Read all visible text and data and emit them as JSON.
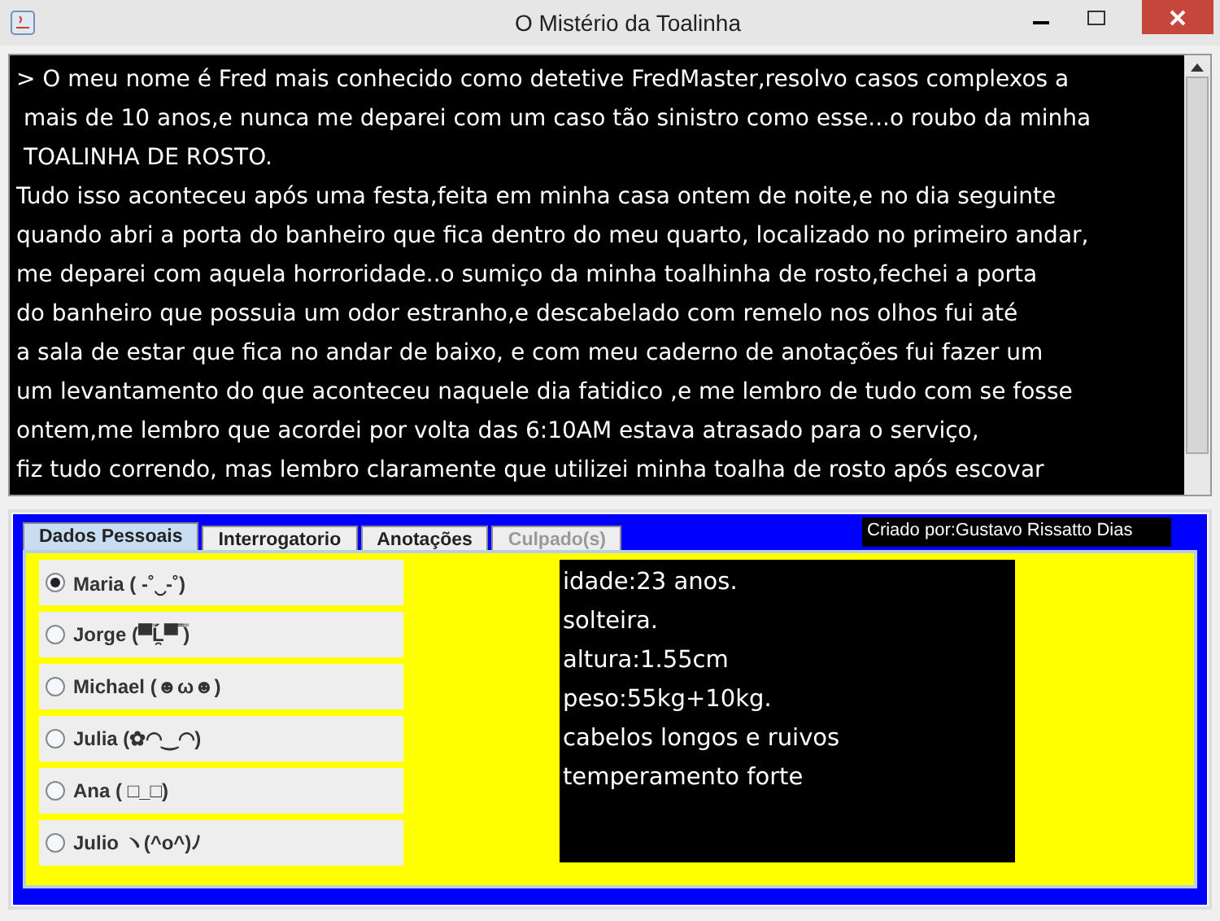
{
  "window": {
    "title": "O Mistério da Toalinha"
  },
  "story": {
    "lines": [
      "> O meu nome é Fred mais conhecido como detetive FredMaster,resolvo casos complexos a",
      " mais de 10 anos,e nunca me deparei com um caso tão sinistro como esse...o roubo da minha",
      " TOALINHA DE ROSTO.",
      "Tudo isso aconteceu após uma festa,feita em minha casa ontem de noite,e no dia seguinte",
      "quando abri a porta do banheiro que fica dentro do meu quarto, localizado no primeiro andar,",
      "me deparei com aquela horroridade..o sumiço da minha toalhinha de rosto,fechei a porta",
      "do banheiro que possuia um odor estranho,e descabelado com remelo nos olhos fui até",
      "a sala de estar que fica no andar de baixo, e com meu caderno de anotações fui fazer um",
      "um levantamento do que aconteceu naquele dia fatidico ,e me lembro de tudo com se fosse",
      "ontem,me lembro que acordei por volta das 6:10AM estava atrasado para o serviço,",
      "fiz tudo correndo, mas lembro claramente que utilizei minha toalha de rosto após escovar"
    ]
  },
  "tabs": [
    {
      "label": "Dados Pessoais",
      "selected": true,
      "disabled": false
    },
    {
      "label": "Interrogatorio",
      "selected": false,
      "disabled": false
    },
    {
      "label": "Anotações",
      "selected": false,
      "disabled": false
    },
    {
      "label": "Culpado(s)",
      "selected": false,
      "disabled": true
    }
  ],
  "credit": "Criado por:Gustavo Rissatto Dias",
  "suspects": [
    {
      "label": "Maria ( -˚‿-˚)",
      "selected": true
    },
    {
      "label": "Jorge (▀̿Ĺ̯▀̿ ̿)",
      "selected": false
    },
    {
      "label": "Michael  (☻ω☻)",
      "selected": false
    },
    {
      "label": "Julia (✿◠‿◠)",
      "selected": false
    },
    {
      "label": "Ana ( □_□)",
      "selected": false
    },
    {
      "label": "Julio ヽ(^o^)ﾉ",
      "selected": false
    }
  ],
  "details": [
    "idade:23 anos.",
    "solteira.",
    "altura:1.55cm",
    "peso:55kg+10kg.",
    "cabelos longos e ruivos",
    "temperamento forte"
  ]
}
